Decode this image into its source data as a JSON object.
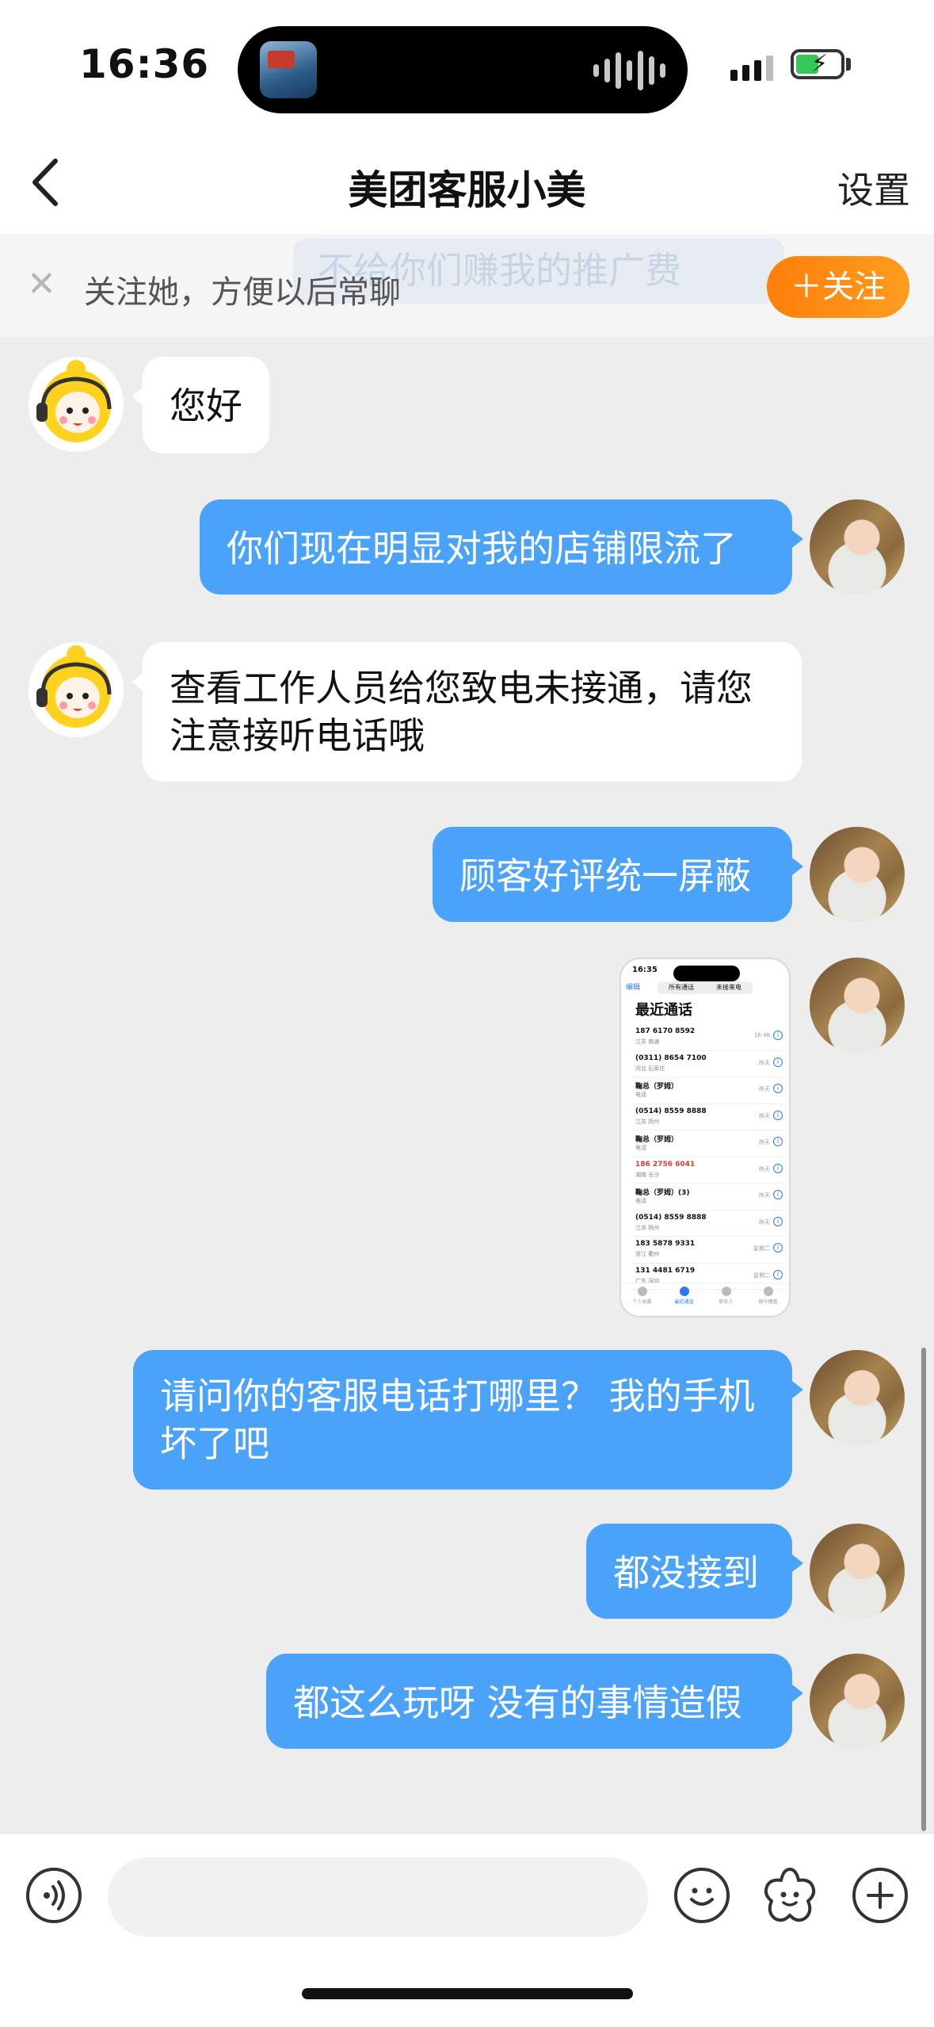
{
  "status_bar": {
    "time": "16:36"
  },
  "nav": {
    "title": "美团客服小美",
    "settings": "设置"
  },
  "follow_banner": {
    "text": "关注她，方便以后常聊",
    "button": "＋关注",
    "background_text": "不给你们赚我的推广费"
  },
  "messages": [
    {
      "from": "agent",
      "text": "您好"
    },
    {
      "from": "user",
      "text": "你们现在明显对我的店铺限流了"
    },
    {
      "from": "agent",
      "text": "查看工作人员给您致电未接通，请您注意接听电话哦"
    },
    {
      "from": "user",
      "text": "顾客好评统一屏蔽"
    },
    {
      "from": "user",
      "type": "image"
    },
    {
      "from": "user",
      "text": "请问你的客服电话打哪里？ 我的手机坏了吧"
    },
    {
      "from": "user",
      "text": "都没接到"
    },
    {
      "from": "user",
      "text": "都这么玩呀 没有的事情造假"
    }
  ],
  "thumb": {
    "time": "16:35",
    "back": "编辑",
    "seg": [
      "所有通话",
      "未接来电"
    ],
    "title": "最近通话",
    "calls": [
      {
        "number": "187 6170 8592",
        "sub": "江苏 南通",
        "date": "16:48"
      },
      {
        "number": "(0311) 8654 7100",
        "sub": "河北 石家庄",
        "date": "昨天"
      },
      {
        "number": "鞠总（罗姆）",
        "sub": "电话",
        "date": "昨天"
      },
      {
        "number": "(0514) 8559 8888",
        "sub": "江苏 扬州",
        "date": "昨天"
      },
      {
        "number": "鞠总（罗姆）",
        "sub": "电话",
        "date": "昨天"
      },
      {
        "number": "186 2756 6041",
        "sub": "湖南 长沙",
        "date": "昨天",
        "missed": true
      },
      {
        "number": "鞠总（罗姆）(3)",
        "sub": "电话",
        "date": "昨天"
      },
      {
        "number": "(0514) 8559 8888",
        "sub": "江苏 扬州",
        "date": "昨天"
      },
      {
        "number": "183 5878 9331",
        "sub": "浙江 衢州",
        "date": "星期二"
      },
      {
        "number": "131 4481 6719",
        "sub": "广东 深圳",
        "date": "星期二"
      }
    ],
    "tabs": [
      "个人收藏",
      "最近通话",
      "联系人",
      "拨号键盘"
    ]
  },
  "input": {
    "placeholder": ""
  },
  "colors": {
    "accent": "#4aa3f9",
    "follow_button": "#ff8a14",
    "background": "#ededed"
  },
  "icons": [
    "back-chevron-icon",
    "close-icon",
    "voice-icon",
    "emoji-icon",
    "sticker-icon",
    "plus-icon"
  ]
}
